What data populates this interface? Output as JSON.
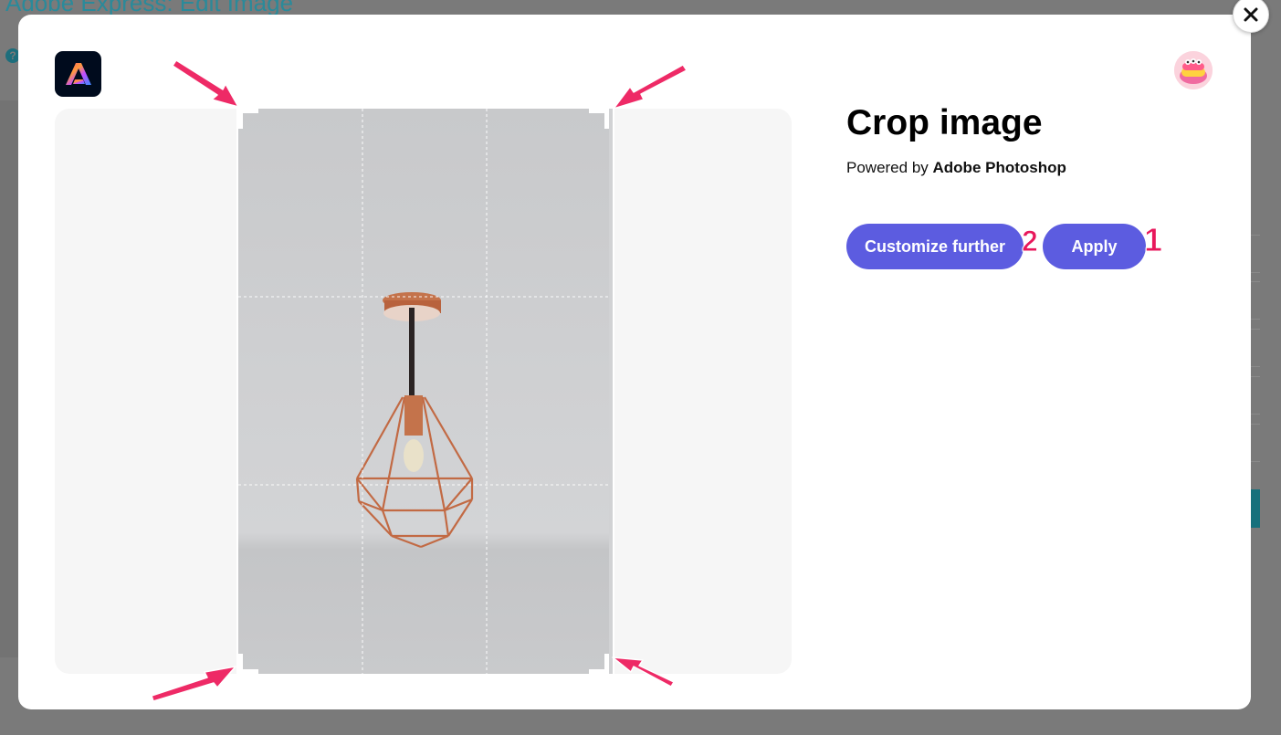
{
  "background": {
    "title": "Adobe Express: Edit Image",
    "help_glyph": "?"
  },
  "modal": {
    "close_icon": "close-icon",
    "app_logo": "adobe-express-logo",
    "avatar": "user-avatar",
    "heading": "Crop image",
    "powered_prefix": "Powered by",
    "powered_brand": "Adobe Photoshop",
    "buttons": {
      "customize": "Customize further",
      "apply": "Apply"
    },
    "annotations": {
      "badge_customize": "2",
      "badge_apply": "1"
    }
  },
  "colors": {
    "accent": "#5c5ce0",
    "annotation": "#e8185c",
    "overlay": "#7a7a7a",
    "background_link": "#2a8a9a"
  }
}
